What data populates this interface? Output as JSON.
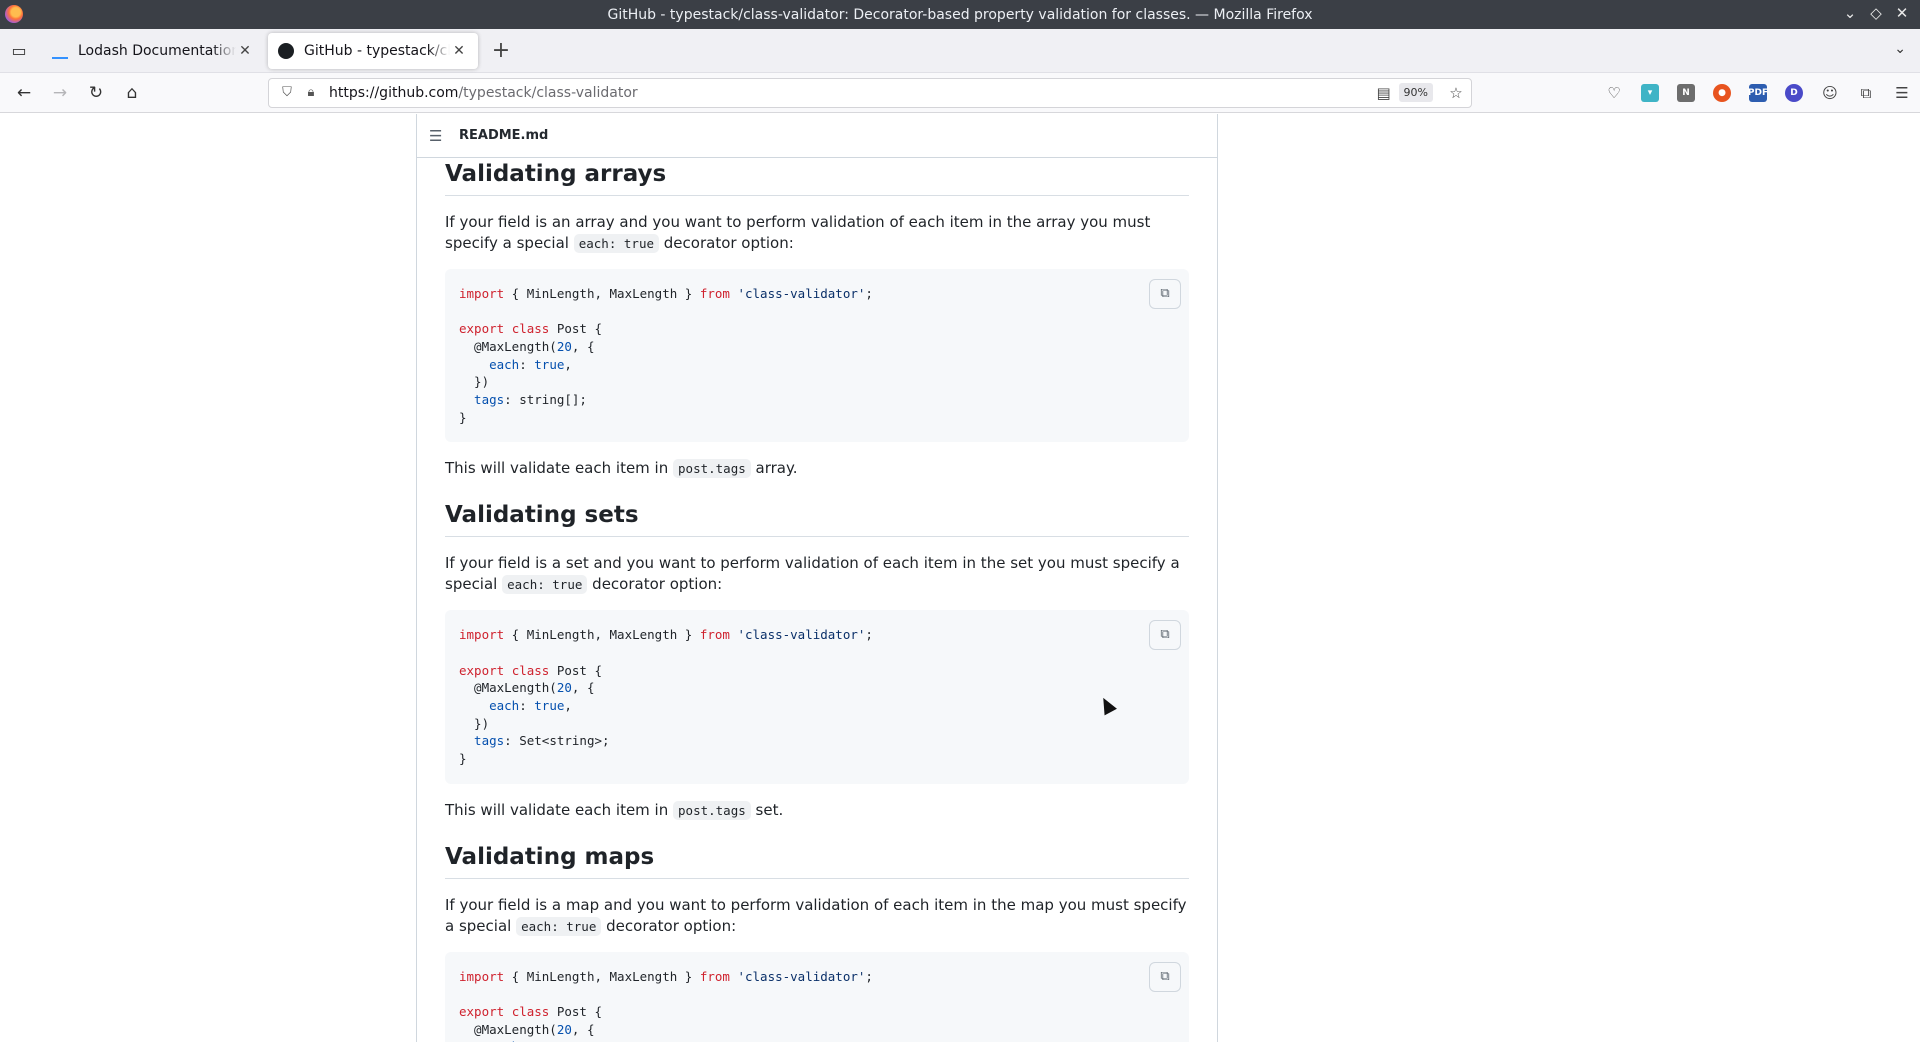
{
  "window": {
    "title": "GitHub - typestack/class-validator: Decorator-based property validation for classes. — Mozilla Firefox"
  },
  "tabs": [
    {
      "label": "Lodash Documentation",
      "active": false
    },
    {
      "label": "GitHub - typestack/class-validator",
      "active": true
    }
  ],
  "navbar": {
    "url_host": "https://github.com",
    "url_path": "/typestack/class-validator",
    "zoom": "90%"
  },
  "readme": {
    "filename": "README.md",
    "sections": [
      {
        "heading": "Validating arrays",
        "intro_pre": "If your field is an array and you want to perform validation of each item in the array you must specify a special",
        "intro_code": "each: true",
        "intro_post": "decorator option:",
        "code_tags_type": "string[];",
        "outro_pre": "This will validate each item in",
        "outro_code": "post.tags",
        "outro_post": "array."
      },
      {
        "heading": "Validating sets",
        "intro_pre": "If your field is a set and you want to perform validation of each item in the set you must specify a special",
        "intro_code": "each: true",
        "intro_post": "decorator option:",
        "code_tags_type": "Set<string>;",
        "outro_pre": "This will validate each item in",
        "outro_code": "post.tags",
        "outro_post": "set."
      },
      {
        "heading": "Validating maps",
        "intro_pre": "If your field is a map and you want to perform validation of each item in the map you must specify a special",
        "intro_code": "each: true",
        "intro_post": "decorator option:"
      }
    ],
    "code": {
      "kw_import": "import",
      "imports": " { MinLength, MaxLength } ",
      "kw_from": "from",
      "module": "'class-validator'",
      "semi": ";",
      "kw_export": "export",
      "kw_class": "class",
      "class_name": " Post {",
      "decorator": "  @MaxLength(",
      "num": "20",
      "dec_rest": ", {",
      "each_key": "    each",
      "each_colon": ": ",
      "each_val": "true",
      "each_comma": ",",
      "close_obj": "  })",
      "tags_key": "  tags",
      "tags_colon": ": ",
      "close_class": "}"
    }
  }
}
